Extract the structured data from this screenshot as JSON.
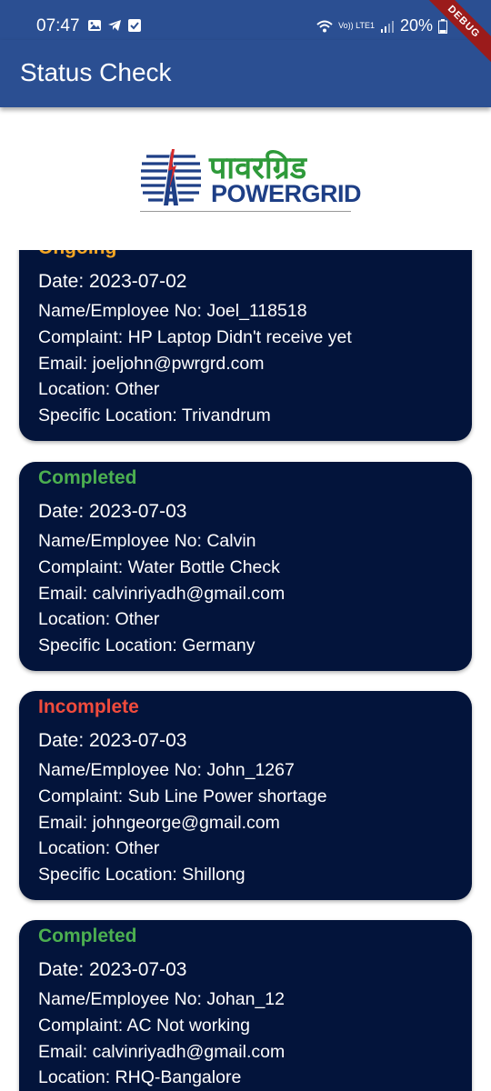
{
  "status_bar": {
    "time": "07:47",
    "battery": "20%",
    "network": "Vo)) LTE1"
  },
  "debug_banner": "DEBUG",
  "app_bar": {
    "title": "Status Check"
  },
  "logo": {
    "hindi_text": "पावरग्रिड",
    "english_text": "POWERGRID"
  },
  "colors": {
    "appbar": "#2b4f92",
    "card": "#03143b",
    "ongoing": "#f5a623",
    "completed": "#4caf50",
    "incomplete": "#f04b3c"
  },
  "complaints": [
    {
      "status": "Ongoing",
      "date": "Date: 2023-07-02",
      "name": "Name/Employee No: Joel_118518",
      "complaint": "Complaint: HP Laptop Didn't receive yet",
      "email": "Email: joeljohn@pwrgrd.com",
      "location": "Location: Other",
      "specific_location": "Specific Location: Trivandrum"
    },
    {
      "status": "Completed",
      "date": "Date: 2023-07-03",
      "name": "Name/Employee No: Calvin",
      "complaint": "Complaint: Water Bottle Check",
      "email": "Email: calvinriyadh@gmail.com",
      "location": "Location: Other",
      "specific_location": "Specific Location: Germany"
    },
    {
      "status": "Incomplete",
      "date": "Date: 2023-07-03",
      "name": "Name/Employee No: John_1267",
      "complaint": "Complaint: Sub Line Power shortage",
      "email": "Email: johngeorge@gmail.com",
      "location": "Location: Other",
      "specific_location": "Specific Location: Shillong"
    },
    {
      "status": "Completed",
      "date": "Date: 2023-07-03",
      "name": "Name/Employee No: Johan_12",
      "complaint": "Complaint: AC Not working",
      "email": "Email: calvinriyadh@gmail.com",
      "location": "Location: RHQ-Bangalore",
      "specific_location": ""
    }
  ]
}
